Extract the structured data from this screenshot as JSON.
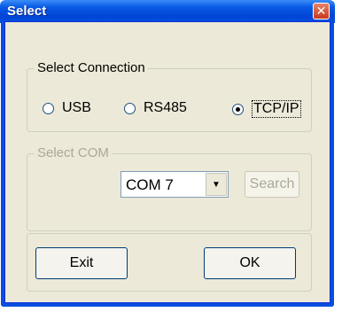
{
  "window": {
    "title": "Select"
  },
  "connection_group": {
    "legend": "Select Connection",
    "options": [
      {
        "label": "USB",
        "checked": false
      },
      {
        "label": "RS485",
        "checked": false
      },
      {
        "label": "TCP/IP",
        "checked": true
      }
    ]
  },
  "com_group": {
    "legend": "Select COM",
    "selected": "COM 7",
    "search_label": "Search"
  },
  "buttons": {
    "exit_label": "Exit",
    "ok_label": "OK"
  },
  "icons": {
    "close": "close-icon",
    "dropdown": "chevron-down-icon"
  },
  "colors": {
    "titlebar": "#0A4EDF",
    "window_bg": "#ECE9D8",
    "close": "#C63A1D"
  }
}
